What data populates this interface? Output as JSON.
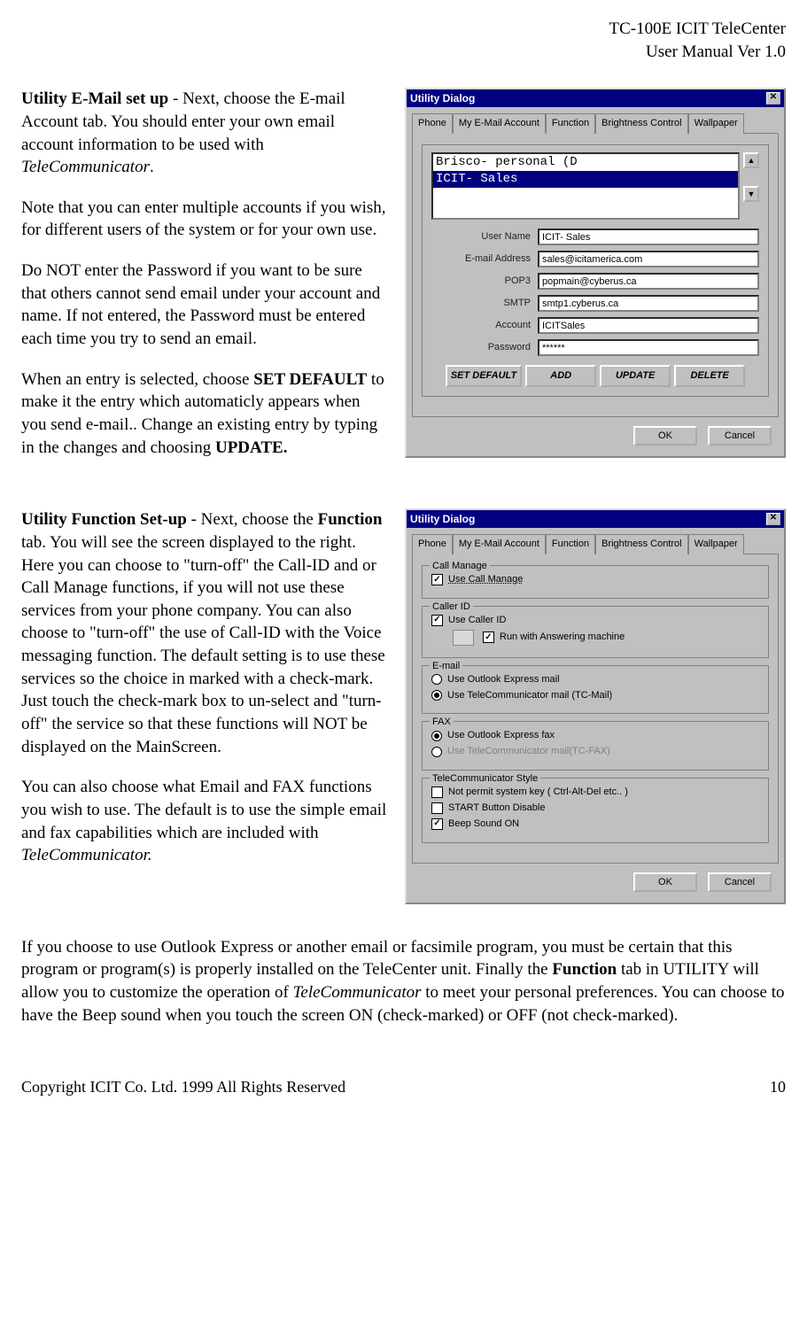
{
  "header": {
    "line1": "TC-100E ICIT TeleCenter",
    "line2": "User Manual  Ver 1.0"
  },
  "section1": {
    "p1_strong": "Utility E-Mail set up",
    "p1_rest": " - Next, choose the E-mail Account tab.  You should enter your own email account information to be used with ",
    "p1_ital": "TeleCommunicator",
    "p1_end": ".",
    "p2": "Note that you can enter multiple accounts if you wish, for different users of the system or for your own use.",
    "p3": "Do NOT enter the Password if you want to be sure that others cannot send email under your account and name. If not entered, the Password must be entered each time you try to send an email.",
    "p4_a": "When an entry is selected, choose ",
    "p4_b": "SET DEFAULT",
    "p4_c": " to make it the entry which automaticly appears when  you send e-mail.. Change an existing entry by typing in the changes and choosing ",
    "p4_d": "UPDATE.",
    "p4_e": ""
  },
  "section2": {
    "p1_a": "Utility Function Set-up",
    "p1_b": " - Next, choose the ",
    "p1_c": "Function",
    "p1_d": " tab. You will see the screen displayed to the right. Here you can choose to \"turn-off\" the Call-ID and or Call Manage functions, if you will not use these services from your phone company. You can also choose to \"turn-off\" the use of Call-ID with the Voice messaging function. The default setting is to use these services so the choice in marked with a check-mark. Just touch the check-mark box to un-select and \"turn-off\" the service so that these functions will NOT be displayed on the MainScreen.",
    "p2_a": "You can also choose what Email and FAX functions you wish to use. The default is to use the simple email and fax capabilities which are included with ",
    "p2_b": "TeleCommunicator.",
    "p3_a": "If you choose to use Outlook Express or another email or facsimile program, you must be certain that this program or program(s) is properly installed on the TeleCenter unit. Finally the ",
    "p3_b": "Function",
    "p3_c": " tab in UTILITY will allow you to customize the operation of ",
    "p3_d": "TeleCommunicator",
    "p3_e": " to meet your personal preferences. You can choose to have the Beep sound when you touch the screen ON (check-marked) or OFF (not check-marked)."
  },
  "footer": {
    "left": "Copyright ICIT Co. Ltd. 1999  All Rights Reserved",
    "right": "10"
  },
  "dlg1": {
    "title": "Utility Dialog",
    "tabs": [
      "Phone",
      "My E-Mail Account",
      "Function",
      "Brightness Control",
      "Wallpaper"
    ],
    "active_tab": 1,
    "list": {
      "item0": "Brisco- personal  (D",
      "item1": "ICIT- Sales"
    },
    "form": {
      "user_label": "User Name",
      "user_value": "ICIT- Sales",
      "email_label": "E-mail Address",
      "email_value": "sales@icitamerica.com",
      "pop3_label": "POP3",
      "pop3_value": "popmain@cyberus.ca",
      "smtp_label": "SMTP",
      "smtp_value": "smtp1.cyberus.ca",
      "account_label": "Account",
      "account_value": "ICITSales",
      "password_label": "Password",
      "password_value": "******"
    },
    "buttons": {
      "set_default": "SET DEFAULT",
      "add": "ADD",
      "update": "UPDATE",
      "delete": "DELETE"
    },
    "ok": "OK",
    "cancel": "Cancel"
  },
  "dlg2": {
    "title": "Utility Dialog",
    "tabs": [
      "Phone",
      "My E-Mail Account",
      "Function",
      "Brightness Control",
      "Wallpaper"
    ],
    "active_tab": 2,
    "groups": {
      "call_manage": {
        "legend": "Call Manage",
        "use": "Use Call Manage"
      },
      "caller_id": {
        "legend": "Caller ID",
        "use": "Use Caller ID",
        "run": "Run with Answering machine"
      },
      "email": {
        "legend": "E-mail",
        "opt1": "Use Outlook Express mail",
        "opt2": "Use TeleCommunicator mail (TC-Mail)"
      },
      "fax": {
        "legend": "FAX",
        "opt1": "Use Outlook Express fax",
        "opt2": "Use TeleCommunicator mail(TC-FAX)"
      },
      "style": {
        "legend": "TeleCommunicator Style",
        "opt1": "Not permit system key ( Ctrl-Alt-Del  etc.. )",
        "opt2": "START Button Disable",
        "opt3": "Beep Sound ON"
      }
    },
    "ok": "OK",
    "cancel": "Cancel"
  }
}
